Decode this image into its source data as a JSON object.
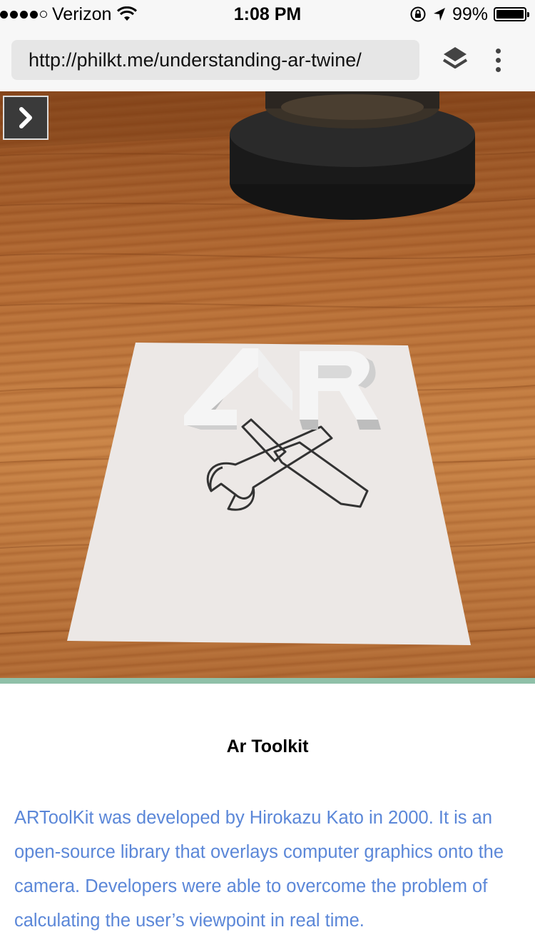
{
  "status_bar": {
    "carrier": "Verizon",
    "signal_bars_filled": 4,
    "signal_bars_total": 5,
    "time": "1:08 PM",
    "battery_percent_label": "99%",
    "battery_level": 0.99,
    "icons": [
      "wifi-icon",
      "orientation-lock-icon",
      "location-arrow-icon",
      "battery-icon"
    ]
  },
  "browser": {
    "url": "http://philkt.me/understanding-ar-twine/",
    "layers_icon": "layers-icon",
    "menu_icon": "more-vertical-icon"
  },
  "camera_view": {
    "next_icon": "chevron-right-icon",
    "overlay_text": "AR",
    "marker_icon": "wrench-screwdriver-icon"
  },
  "article": {
    "title": "Ar Toolkit",
    "body": "ARToolKit was developed by Hirokazu Kato in 2000. It is an open-source library that overlays computer graphics onto the camera. Developers were able to overcome the problem of calculating the user’s viewpoint in real time."
  },
  "colors": {
    "link_text": "#5b87d8",
    "bar_bg": "#f7f7f7",
    "url_box_bg": "#e6e6e6"
  }
}
